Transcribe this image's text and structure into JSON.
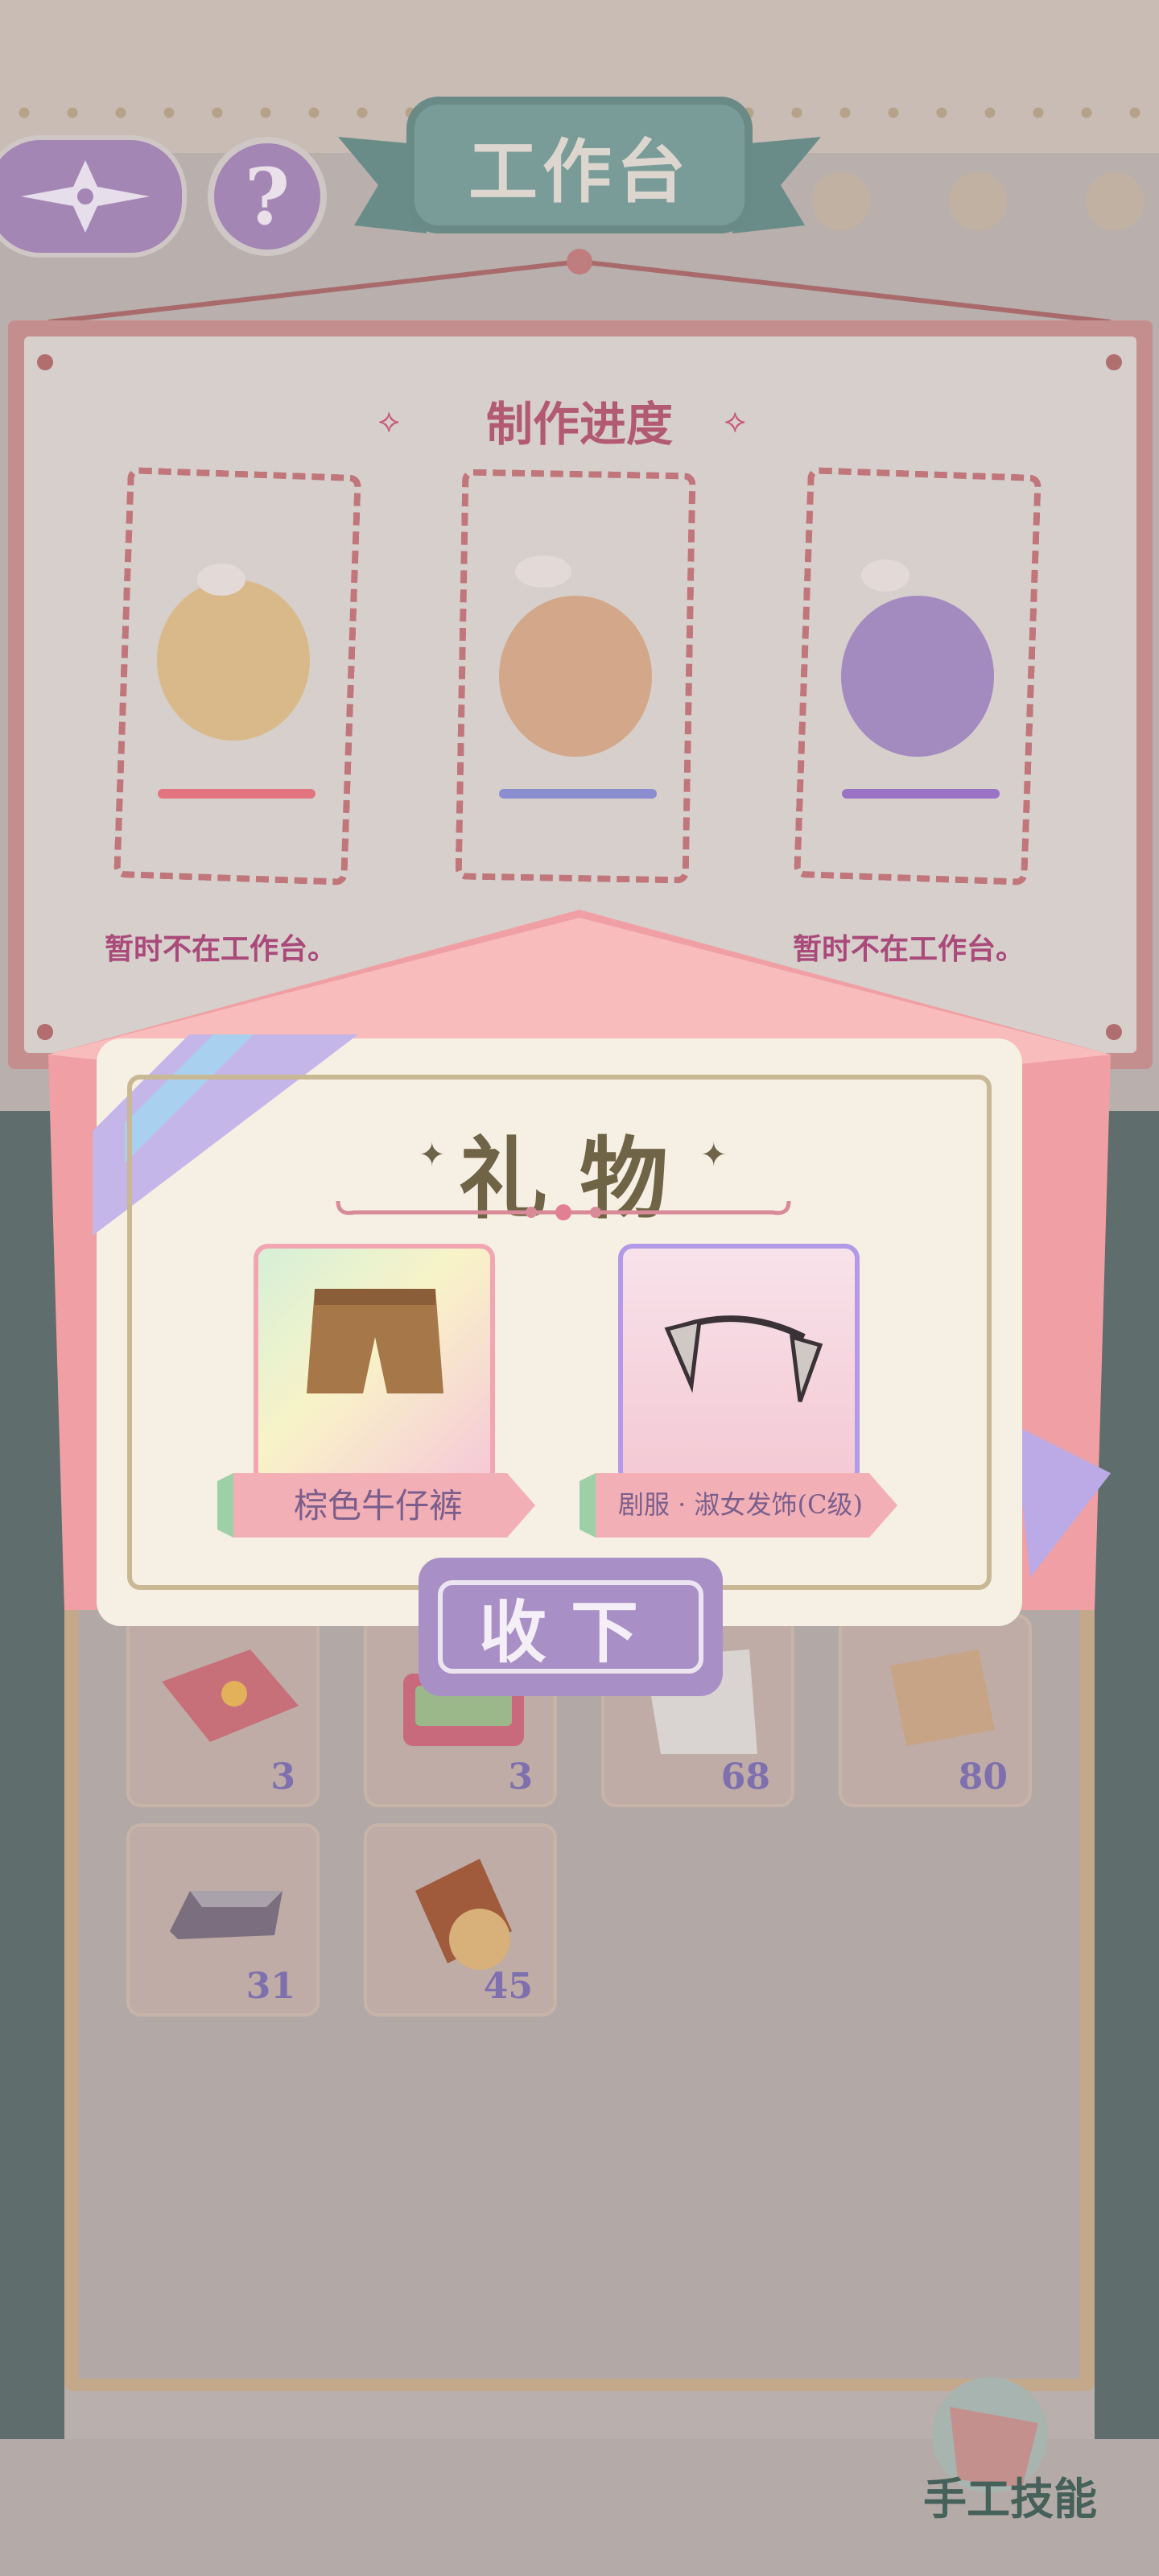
{
  "header": {
    "title": "工作台",
    "help_label": "?"
  },
  "progress": {
    "title": "制作进度",
    "slots": [
      {
        "status": "暂时不在工作台。",
        "accent": "#e2757f"
      },
      {
        "status": "",
        "accent": "#8a8ed0"
      },
      {
        "status": "暂时不在工作台。",
        "accent": "#9a72c6"
      }
    ]
  },
  "inventory": {
    "items": [
      {
        "icon": "pillow-icon",
        "count": "3"
      },
      {
        "icon": "sewing-box-icon",
        "count": "3"
      },
      {
        "icon": "cloth-icon",
        "count": "68"
      },
      {
        "icon": "fabric-bundle-icon",
        "count": "80"
      },
      {
        "icon": "metal-ingot-icon",
        "count": "31"
      },
      {
        "icon": "wood-log-icon",
        "count": "45"
      }
    ]
  },
  "gift_dialog": {
    "title": "礼物",
    "items": [
      {
        "name": "棕色牛仔裤",
        "icon": "brown-shorts-icon"
      },
      {
        "name": "剧服 · 淑女发饰(C级)",
        "icon": "lady-hair-accessory-icon"
      }
    ],
    "accept_label": "收下"
  },
  "footer": {
    "skill_label": "手工技能"
  },
  "colors": {
    "accent_purple": "#a890c6",
    "title_teal": "#7a9c98",
    "progress_pink": "#b25a72"
  }
}
